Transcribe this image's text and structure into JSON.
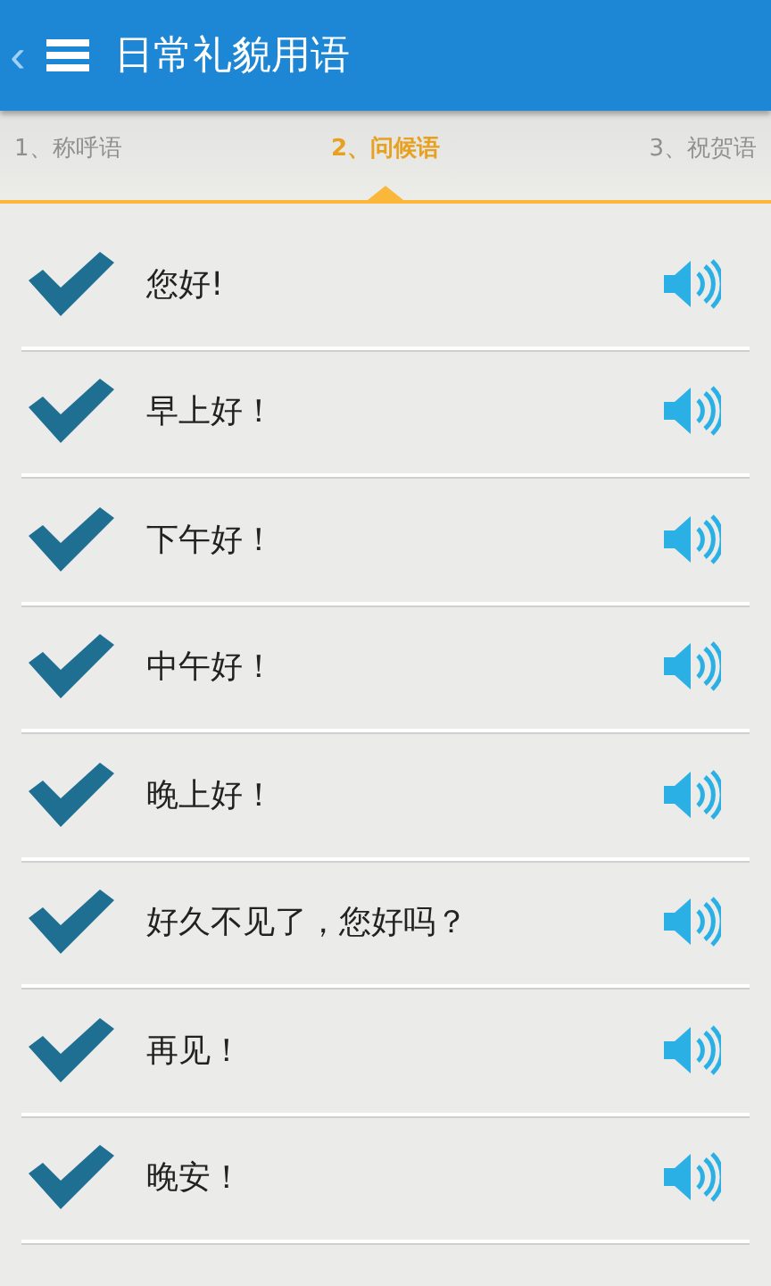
{
  "header": {
    "back": "‹",
    "title": "日常礼貌用语"
  },
  "tabs": [
    {
      "label": "1、称呼语",
      "selected": false
    },
    {
      "label": "2、问候语",
      "selected": true
    },
    {
      "label": "3、祝贺语",
      "selected": false
    }
  ],
  "phrases": [
    {
      "text": "您好!",
      "checked": true
    },
    {
      "text": "早上好！",
      "checked": true
    },
    {
      "text": "下午好！",
      "checked": true
    },
    {
      "text": "中午好！",
      "checked": true
    },
    {
      "text": "晚上好！",
      "checked": true
    },
    {
      "text": "好久不见了，您好吗？",
      "checked": true
    },
    {
      "text": "再见！",
      "checked": true
    },
    {
      "text": "晚安！",
      "checked": true
    }
  ]
}
